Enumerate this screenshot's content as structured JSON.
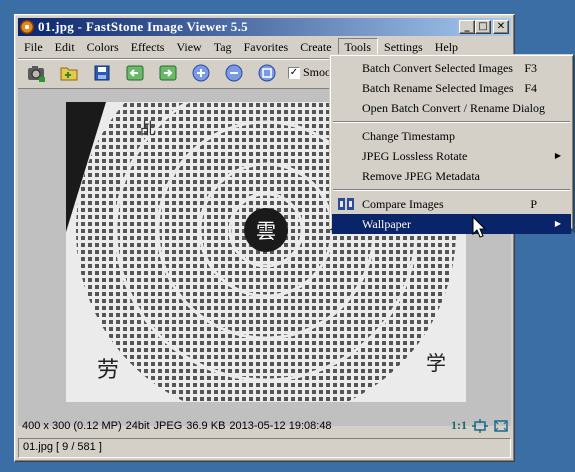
{
  "window": {
    "title": "01.jpg  -  FastStone Image Viewer 5.5",
    "min_label": "_",
    "max_label": "□",
    "close_label": "✕"
  },
  "menubar": {
    "items": [
      "File",
      "Edit",
      "Colors",
      "Effects",
      "View",
      "Tag",
      "Favorites",
      "Create",
      "Tools",
      "Settings",
      "Help"
    ]
  },
  "toolbar": {
    "buttons": [
      "camera-icon",
      "open-folder-icon",
      "save-icon",
      "previous-icon",
      "next-icon",
      "zoom-in-icon",
      "zoom-out-icon",
      "actual-size-icon"
    ],
    "smooth_label": "Smoo",
    "smooth_checked": true
  },
  "image": {
    "labels": [
      "乩",
      "雲",
      "劳",
      "学"
    ]
  },
  "statusbar": {
    "dimensions": "400 x 300 (0.12 MP)",
    "bitdepth": "24bit",
    "format": "JPEG",
    "filesize": "36.9 KB",
    "datetime": "2013-05-12 19:08:48",
    "ratio": "1:1"
  },
  "statusbar2": {
    "file_info": "01.jpg [ 9 / 581 ]"
  },
  "tools_menu": {
    "items": [
      {
        "label": "Batch Convert Selected Images",
        "shortcut": "F3"
      },
      {
        "label": "Batch Rename Selected Images",
        "shortcut": "F4"
      },
      {
        "label": "Open Batch Convert / Rename Dialog",
        "shortcut": ""
      },
      {
        "label": "Change Timestamp",
        "shortcut": ""
      },
      {
        "label": "JPEG Lossless Rotate",
        "shortcut": "",
        "submenu": true
      },
      {
        "label": "Remove JPEG Metadata",
        "shortcut": ""
      },
      {
        "label": "Compare Images",
        "shortcut": "P",
        "icon": "compare-icon"
      },
      {
        "label": "Wallpaper",
        "shortcut": "",
        "submenu": true,
        "highlighted": true
      }
    ]
  },
  "colors": {
    "titlebar_start": "#0a246a",
    "titlebar_end": "#a6caf0",
    "desktop": "#3a6ea5",
    "highlight": "#0a246a"
  }
}
